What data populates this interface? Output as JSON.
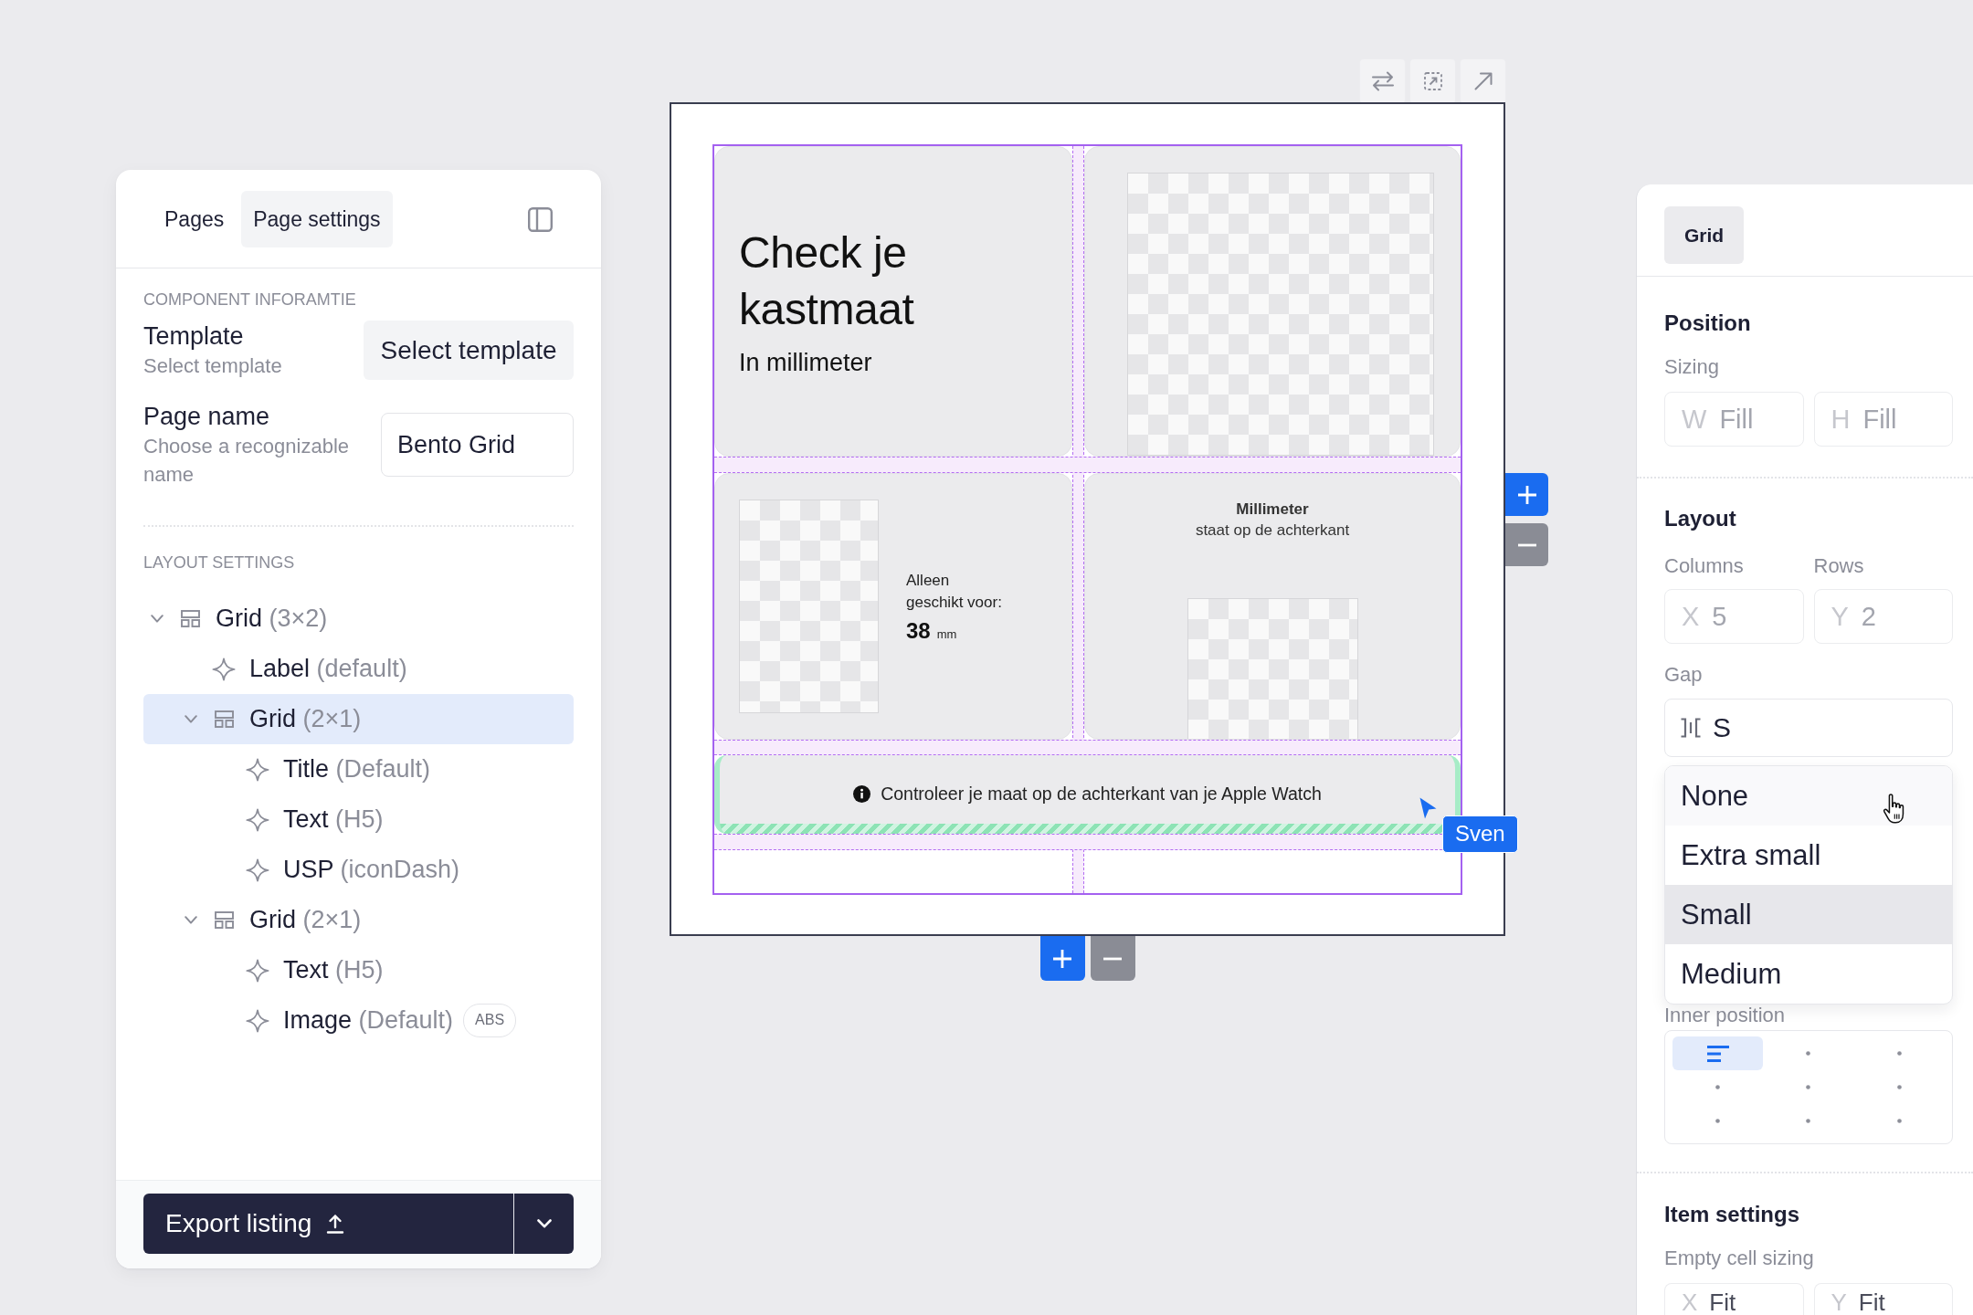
{
  "left_panel": {
    "tabs": [
      {
        "label": "Pages",
        "selected": false
      },
      {
        "label": "Page settings",
        "selected": true
      }
    ],
    "component_info": {
      "heading": "COMPONENT INFORAMTIE",
      "fields": [
        {
          "kind": "button",
          "label": "Template",
          "description": "Select template",
          "value": "Select template"
        },
        {
          "kind": "input",
          "label": "Page name",
          "description": "Choose a recognizable name",
          "value": "Bento Grid"
        }
      ]
    },
    "layout_settings": {
      "heading": "LAYOUT SETTINGS",
      "tree": [
        {
          "kind": "grid",
          "name": "Grid",
          "detail": "(3×2)",
          "expanded": true,
          "selected": false,
          "children": [
            {
              "kind": "component",
              "name": "Label",
              "detail": "(default)",
              "selected": false
            },
            {
              "kind": "grid",
              "name": "Grid",
              "detail": "(2×1)",
              "expanded": true,
              "selected": true,
              "children": [
                {
                  "kind": "component",
                  "name": "Title",
                  "detail": "(Default)",
                  "selected": false
                },
                {
                  "kind": "component",
                  "name": "Text",
                  "detail": "(H5)",
                  "selected": false
                },
                {
                  "kind": "component",
                  "name": "USP",
                  "detail": "(iconDash)",
                  "selected": false
                }
              ]
            },
            {
              "kind": "grid",
              "name": "Grid",
              "detail": "(2×1)",
              "expanded": true,
              "selected": false,
              "children": [
                {
                  "kind": "component",
                  "name": "Text",
                  "detail": "(H5)",
                  "selected": false
                },
                {
                  "kind": "component",
                  "name": "Image",
                  "detail": "(Default)",
                  "badge": "ABS",
                  "selected": false
                }
              ]
            }
          ]
        }
      ]
    },
    "export_button": {
      "label": "Export listing"
    }
  },
  "canvas": {
    "cells": [
      {
        "kind": "title",
        "title": "Check je kastmaat",
        "subtitle": "In millimeter"
      },
      {
        "kind": "image"
      },
      {
        "kind": "size",
        "text": "Alleen geschikt voor:",
        "value": "38",
        "unit": "mm"
      },
      {
        "kind": "caption",
        "title": "Millimeter",
        "text": "staat op de achterkant"
      }
    ],
    "banner": {
      "text": "Controleer je maat op de achterkant van je Apple Watch",
      "highlighted": true
    },
    "cursor": {
      "label": "Sven"
    }
  },
  "right_panel": {
    "tabs": [
      {
        "label": "Grid",
        "selected": true
      }
    ],
    "position": {
      "heading": "Position",
      "sizing": {
        "label": "Sizing",
        "fields": [
          {
            "prefix": "W",
            "placeholder": "Fill"
          },
          {
            "prefix": "H",
            "placeholder": "Fill"
          }
        ]
      }
    },
    "layout": {
      "heading": "Layout",
      "columns": {
        "label": "Columns",
        "prefix": "X",
        "placeholder": "5"
      },
      "rows": {
        "label": "Rows",
        "prefix": "Y",
        "placeholder": "2"
      },
      "gap": {
        "label": "Gap",
        "value": "S",
        "expanded": true,
        "options": [
          {
            "label": "None",
            "hovered": true,
            "selected": false
          },
          {
            "label": "Extra small",
            "hovered": false,
            "selected": false
          },
          {
            "label": "Small",
            "hovered": false,
            "selected": true
          },
          {
            "label": "Medium",
            "hovered": false,
            "selected": false
          }
        ]
      },
      "inner_position": {
        "label": "Inner position",
        "cells": [
          {
            "selected": true
          },
          {
            "selected": false
          },
          {
            "selected": false
          },
          {
            "selected": false
          },
          {
            "selected": false
          },
          {
            "selected": false
          },
          {
            "selected": false
          },
          {
            "selected": false
          },
          {
            "selected": false
          }
        ]
      }
    },
    "item_settings": {
      "heading": "Item settings",
      "empty_cell_sizing": {
        "label": "Empty cell sizing",
        "fields": [
          {
            "prefix": "X",
            "value": "Fit"
          },
          {
            "prefix": "Y",
            "value": "Fit"
          }
        ]
      }
    }
  }
}
